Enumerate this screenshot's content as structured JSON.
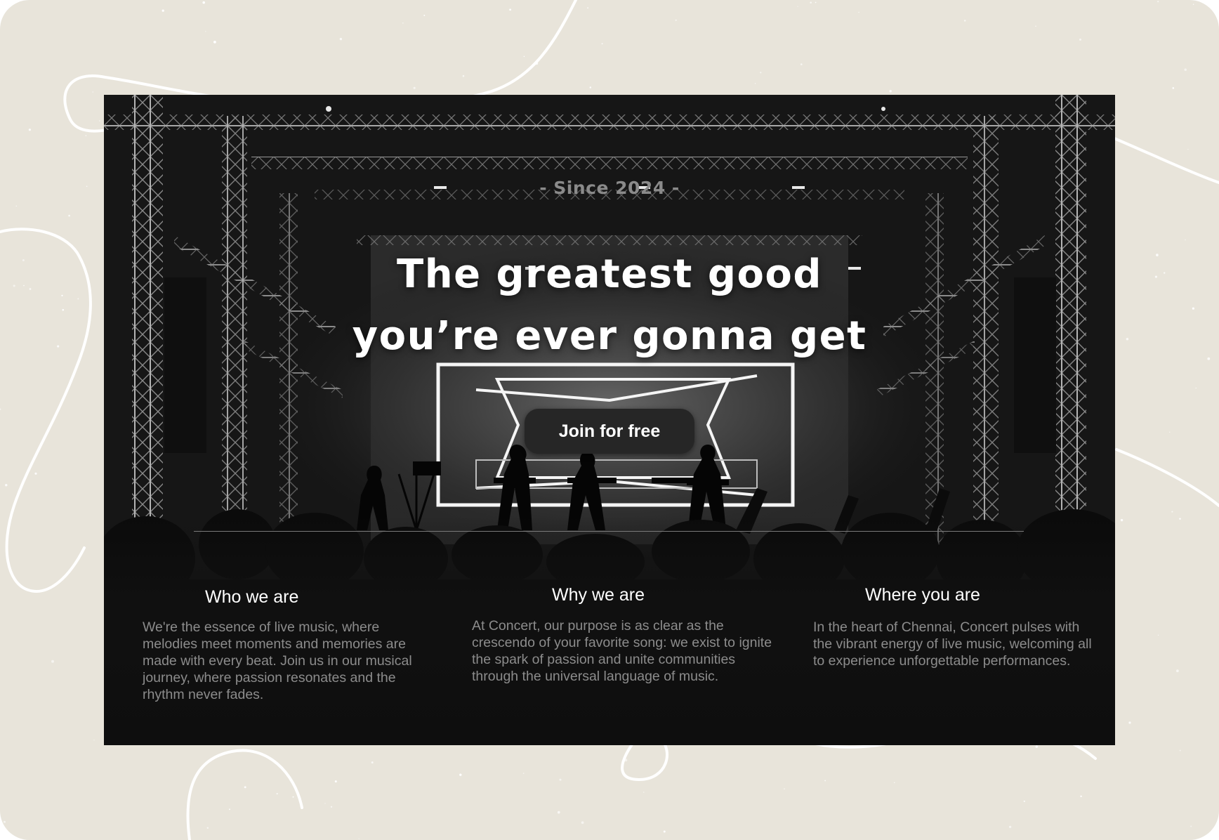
{
  "theme": {
    "backdrop_color": "#e8e4da",
    "card_color": "#111111",
    "accent_text": "#ffffff",
    "muted_text": "#8c8c8c",
    "button_color": "#262626"
  },
  "hero": {
    "since": "- Since 2024 -",
    "headline_line1": "The greatest good",
    "headline_line2": "you’re ever gonna get",
    "cta_label": "Join for free"
  },
  "features": [
    {
      "title": "Who we are",
      "text": "We're the essence of live music, where melodies meet moments and  memories are made with every beat. Join us in our musical journey, where  passion resonates and the rhythm never fades."
    },
    {
      "title": "Why we are",
      "text": "At Concert, our purpose is as clear as the crescendo of  your favorite song: we exist to ignite the spark of passion and unite communities through the universal language of music."
    },
    {
      "title": "Where you are",
      "text": "In the heart of Chennai, Concert pulses with the  vibrant energy of live music, welcoming all to experience unforgettable performances."
    }
  ],
  "icons": {
    "background_photo": "concert-stage-photo-icon"
  }
}
